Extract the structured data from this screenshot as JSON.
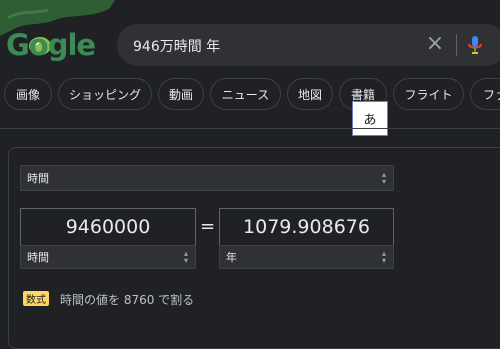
{
  "logo": {
    "text": "Gogle"
  },
  "search": {
    "query": "946万時間 年",
    "clear_icon": "close-icon",
    "mic_icon": "microphone-icon"
  },
  "chips": [
    {
      "label": "画像"
    },
    {
      "label": "ショッピング"
    },
    {
      "label": "動画"
    },
    {
      "label": "ニュース"
    },
    {
      "label": "地図"
    },
    {
      "label": "書籍"
    },
    {
      "label": "フライト"
    },
    {
      "label": "ファ"
    }
  ],
  "ime": {
    "candidate": "あ"
  },
  "converter": {
    "unit_type": "時間",
    "from": {
      "value": "9460000",
      "unit": "時間"
    },
    "equals": "=",
    "to": {
      "value": "1079.908676",
      "unit": "年"
    },
    "formula_badge": "数式",
    "formula": "時間の値を 8760 で割る"
  },
  "colors": {
    "background": "#202124",
    "badge": "#fdd663",
    "logo_green": "#3c8b54"
  }
}
